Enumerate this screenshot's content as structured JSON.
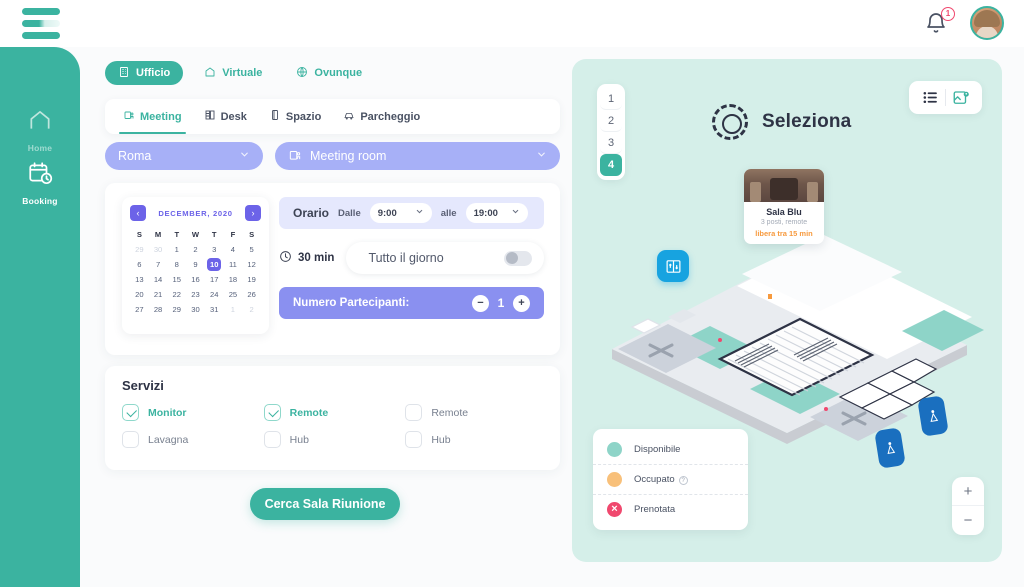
{
  "header": {
    "logo_name": "logo-bars",
    "notification_icon": "bell-icon",
    "notification_count": "1",
    "avatar_name": "user-avatar"
  },
  "sidebar": {
    "items": [
      {
        "label": "Home",
        "icon": "home-icon",
        "active": false
      },
      {
        "label": "Booking",
        "icon": "calendar-clock-icon",
        "active": true
      }
    ]
  },
  "location_pills": [
    {
      "label": "Ufficio",
      "icon": "office-building-icon",
      "active": true
    },
    {
      "label": "Virtuale",
      "icon": "house-icon",
      "active": false
    },
    {
      "label": "Ovunque",
      "icon": "globe-icon",
      "active": false
    }
  ],
  "tabs": [
    {
      "label": "Meeting",
      "icon": "meeting-room-icon",
      "active": true
    },
    {
      "label": "Desk",
      "icon": "desk-icon",
      "active": false
    },
    {
      "label": "Spazio",
      "icon": "space-icon",
      "active": false
    },
    {
      "label": "Parcheggio",
      "icon": "parking-icon",
      "active": false
    }
  ],
  "selectors": {
    "city": {
      "value": "Roma",
      "chevron": "chevron-down-icon"
    },
    "room_type": {
      "value": "Meeting room",
      "icon": "meeting-room-icon",
      "chevron": "chevron-down-icon"
    }
  },
  "calendar": {
    "title": "DECEMBER, 2020",
    "prev_icon": "chevron-left-icon",
    "next_icon": "chevron-right-icon",
    "dow": [
      "S",
      "M",
      "T",
      "W",
      "T",
      "F",
      "S"
    ],
    "weeks": [
      [
        {
          "d": "29",
          "m": true
        },
        {
          "d": "30",
          "m": true
        },
        {
          "d": "1"
        },
        {
          "d": "2"
        },
        {
          "d": "3"
        },
        {
          "d": "4"
        },
        {
          "d": "5"
        }
      ],
      [
        {
          "d": "6"
        },
        {
          "d": "7"
        },
        {
          "d": "8"
        },
        {
          "d": "9"
        },
        {
          "d": "10",
          "sel": true
        },
        {
          "d": "11"
        },
        {
          "d": "12"
        }
      ],
      [
        {
          "d": "13"
        },
        {
          "d": "14"
        },
        {
          "d": "15"
        },
        {
          "d": "16"
        },
        {
          "d": "17"
        },
        {
          "d": "18"
        },
        {
          "d": "19"
        }
      ],
      [
        {
          "d": "20"
        },
        {
          "d": "21"
        },
        {
          "d": "22"
        },
        {
          "d": "23"
        },
        {
          "d": "24"
        },
        {
          "d": "25"
        },
        {
          "d": "26"
        }
      ],
      [
        {
          "d": "27"
        },
        {
          "d": "28"
        },
        {
          "d": "29"
        },
        {
          "d": "30"
        },
        {
          "d": "31"
        },
        {
          "d": "1",
          "m": true
        },
        {
          "d": "2",
          "m": true
        }
      ]
    ]
  },
  "time": {
    "label": "Orario",
    "from_label": "Dalle",
    "from_value": "9:00",
    "to_label": "alle",
    "to_value": "19:00",
    "duration": "30 min",
    "duration_icon": "clock-icon",
    "all_day_label": "Tutto il giorno",
    "all_day_on": false
  },
  "participants": {
    "label": "Numero Partecipanti:",
    "value": "1",
    "minus": "−",
    "plus": "+"
  },
  "services": {
    "title": "Servizi",
    "items": [
      {
        "label": "Monitor",
        "checked": true
      },
      {
        "label": "Remote",
        "checked": true
      },
      {
        "label": "Remote",
        "checked": false
      },
      {
        "label": "Lavagna",
        "checked": false
      },
      {
        "label": "Hub",
        "checked": false
      },
      {
        "label": "Hub",
        "checked": false
      }
    ]
  },
  "cta": {
    "label": "Cerca Sala Riunione"
  },
  "map": {
    "title": "Seleziona",
    "title_icon": "dashed-ring-icon",
    "floors": [
      {
        "label": "1",
        "active": false
      },
      {
        "label": "2",
        "active": false
      },
      {
        "label": "3",
        "active": false
      },
      {
        "label": "4",
        "active": true
      }
    ],
    "view_toggle": [
      {
        "icon": "list-view-icon",
        "active": false
      },
      {
        "icon": "map-view-icon",
        "active": true
      }
    ],
    "room_card": {
      "name": "Sala Blu",
      "details": "3 posti, remote",
      "status": "libera tra 15 min",
      "image": "meeting-room-photo"
    },
    "legend": [
      {
        "label": "Disponibile",
        "color": "#8ed4c8",
        "style": "dot",
        "help": false
      },
      {
        "label": "Occupato",
        "color": "#f8c07a",
        "style": "dot",
        "help": true
      },
      {
        "label": "Prenotata",
        "color": "#f0486e",
        "style": "x",
        "help": false
      }
    ],
    "zoom_in": "+",
    "zoom_out": "−",
    "markers": [
      {
        "icon": "elevator-icon",
        "color": "#17a3e0"
      },
      {
        "icon": "restroom-icon",
        "color": "#1a6fbf"
      },
      {
        "icon": "restroom-icon",
        "color": "#1a6fbf"
      }
    ]
  },
  "colors": {
    "brand_teal": "#3bb3a0",
    "periwinkle": "#a7b0f7",
    "indigo": "#6c63e8",
    "map_bg": "#d5efe9",
    "orange": "#f79a3e",
    "pink": "#f0486e"
  }
}
